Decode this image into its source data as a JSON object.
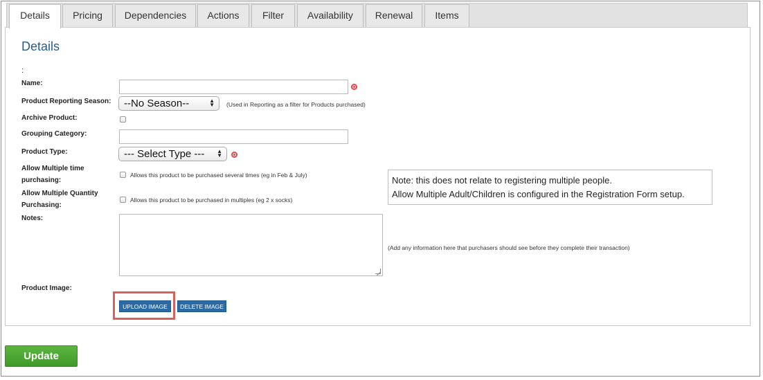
{
  "tabs": [
    {
      "label": "Details"
    },
    {
      "label": "Pricing"
    },
    {
      "label": "Dependencies"
    },
    {
      "label": "Actions"
    },
    {
      "label": "Filter"
    },
    {
      "label": "Availability"
    },
    {
      "label": "Renewal"
    },
    {
      "label": "Items"
    }
  ],
  "section": {
    "title": "Details",
    "colon": ":"
  },
  "form": {
    "name_label": "Name:",
    "name_value": "",
    "season_label": "Product Reporting Season:",
    "season_selected": "--No Season--",
    "season_hint": "(Used in Reporting as a filter for Products purchased)",
    "archive_label": "Archive Product:",
    "grouping_label": "Grouping Category:",
    "grouping_value": "",
    "type_label": "Product Type:",
    "type_selected": "--- Select Type ---",
    "multi_time_label_1": "Allow Multiple time",
    "multi_time_label_2": "purchasing:",
    "multi_time_hint": "Allows this product to be purchased several times (eg in Feb & July)",
    "multi_qty_label_1": "Allow Multiple Quantity",
    "multi_qty_label_2": "Purchasing:",
    "multi_qty_hint": "Allows this product to be purchased in multiples (eg 2 x socks)",
    "notes_label": "Notes:",
    "notes_value": "",
    "notes_hint": "(Add any information here that purchasers should see before they complete their transaction)",
    "image_label": "Product Image:",
    "upload_label": "UPLOAD IMAGE",
    "delete_label": "DELETE IMAGE"
  },
  "note": {
    "line1": "Note: this does not relate to registering multiple people.",
    "line2": "Allow Multiple Adult/Children is configured in the Registration Form setup."
  },
  "update_label": "Update",
  "colors": {
    "accent_blue": "#2a6ba6",
    "title_blue": "#2a5b8c",
    "update_green": "#4ea834",
    "required_red": "#d94a4a",
    "highlight_red": "#d9615a"
  }
}
